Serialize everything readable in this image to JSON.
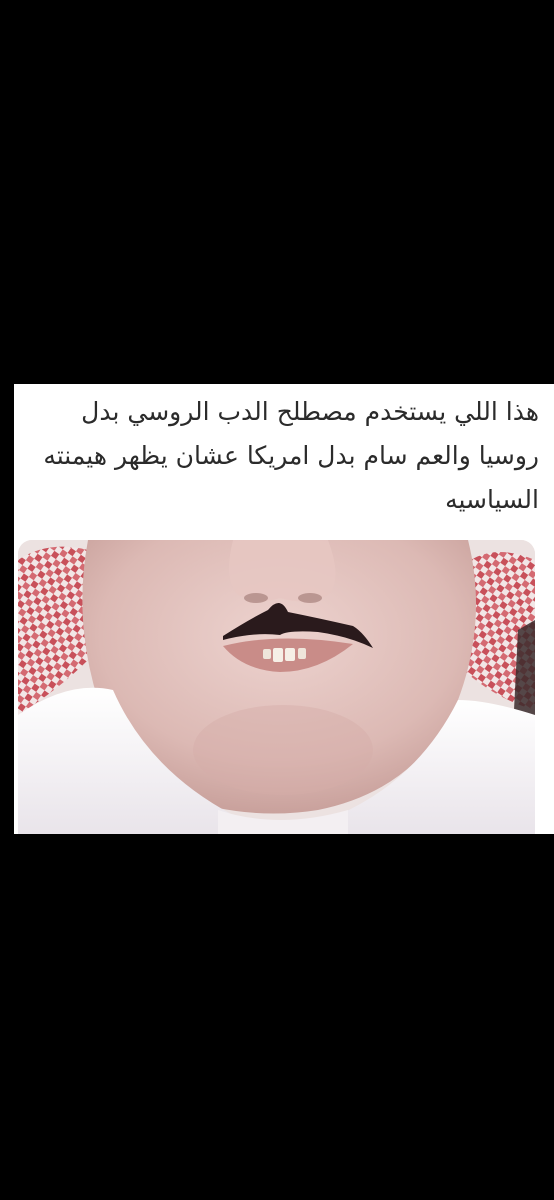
{
  "post": {
    "caption": "هذا اللي يستخدم مصطلح الدب الروسي بدل روسيا والعم سام بدل امريكا عشان يظهر هيمنته السياسيه"
  },
  "photo": {
    "subject": "meme-face-photo",
    "colors": {
      "skin": "#e3c4c0",
      "thobe": "#f4f1f2",
      "shemagh_red": "#c8505a",
      "mustache": "#2a1a1c",
      "background": "#000000"
    }
  }
}
